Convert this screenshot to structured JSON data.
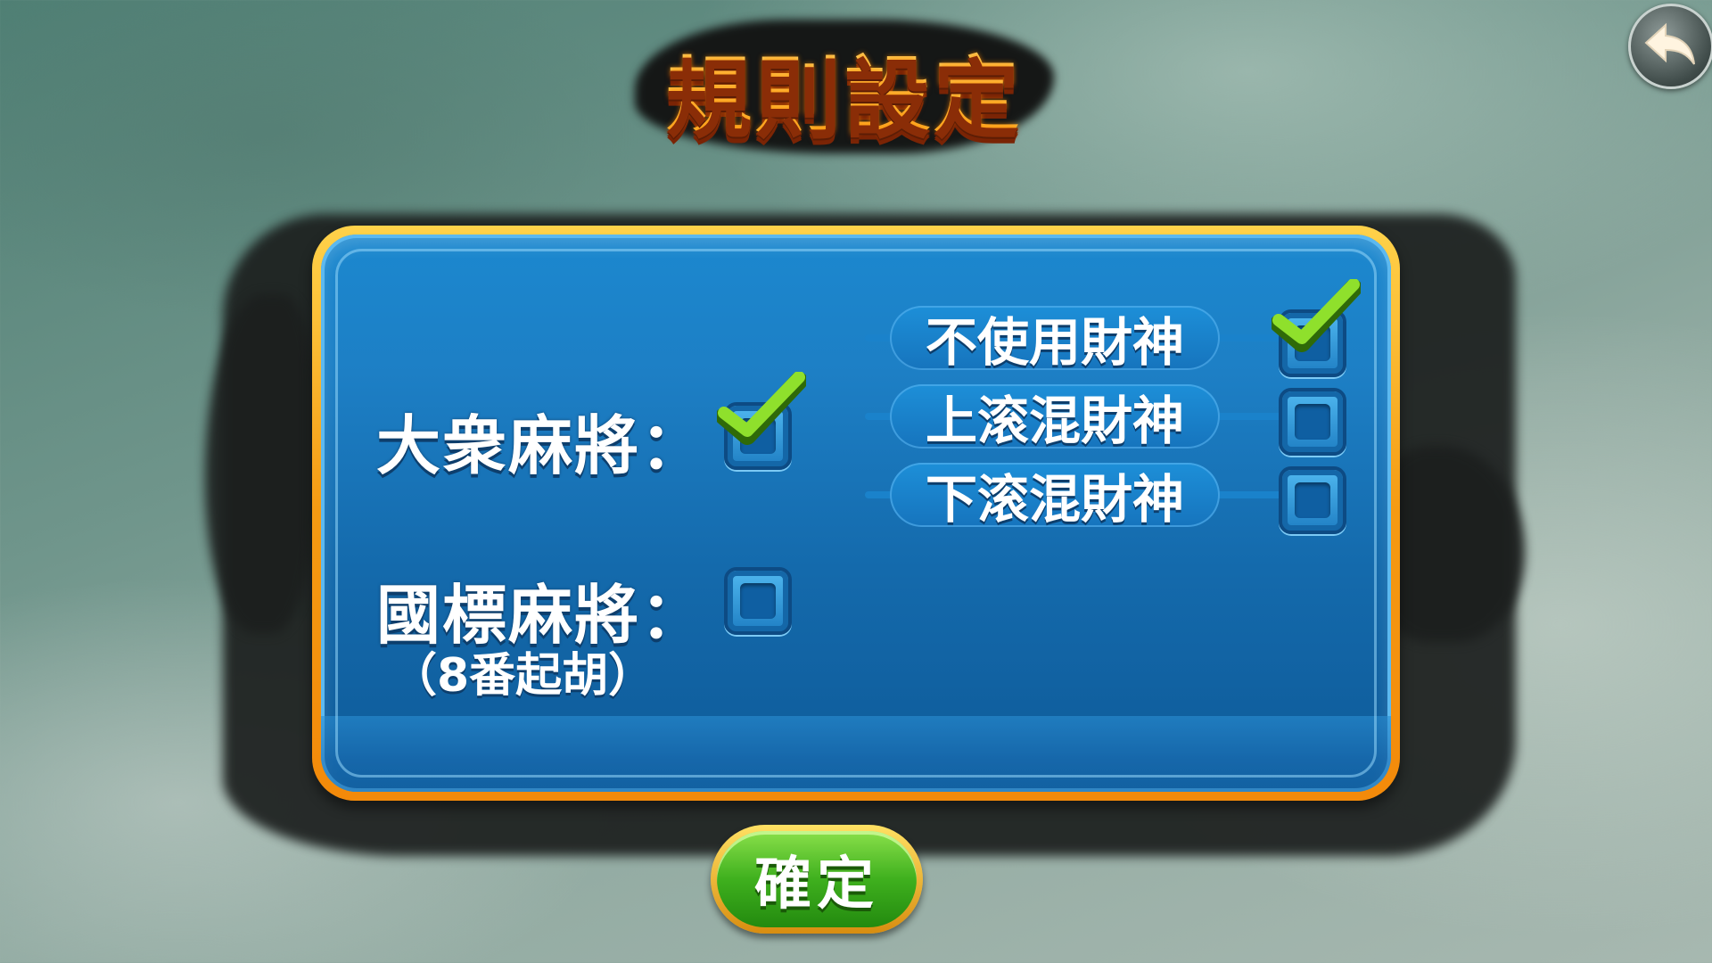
{
  "header": {
    "title": "規則設定"
  },
  "nav": {
    "back_icon": "back-arrow-icon"
  },
  "rules": {
    "dazhong": {
      "label": "大衆麻將：",
      "checked": true
    },
    "guobiao": {
      "label": "國標麻將：",
      "sublabel": "（8番起胡）",
      "checked": false
    },
    "wild_options": [
      {
        "label": "不使用財神",
        "checked": true
      },
      {
        "label": "上滚混財神",
        "checked": false
      },
      {
        "label": "下滚混財神",
        "checked": false
      }
    ]
  },
  "footer": {
    "confirm_label": "確定"
  },
  "colors": {
    "panel_blue": "#1b88cf",
    "panel_border": "#f59a12",
    "title_gold": "#ffc13b",
    "check_green": "#7ed321",
    "confirm_green": "#3fb01e"
  }
}
